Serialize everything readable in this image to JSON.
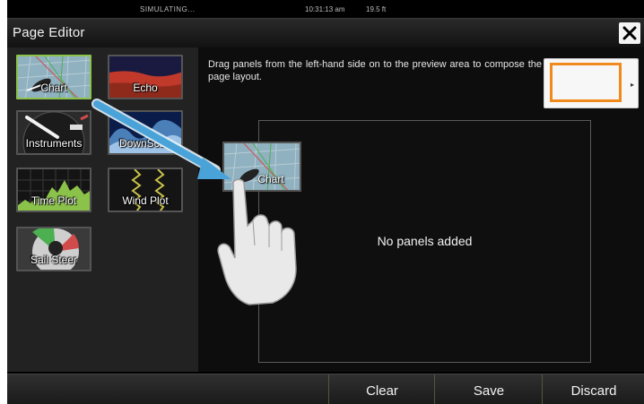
{
  "status": {
    "sim": "SIMULATING...",
    "time": "10:31:13 am",
    "depth": "19.5 ft"
  },
  "title": "Page Editor",
  "panels": [
    {
      "label": "Chart",
      "icon": "chart-icon"
    },
    {
      "label": "Echo",
      "icon": "echo-icon"
    },
    {
      "label": "Instruments",
      "icon": "instruments-icon"
    },
    {
      "label": "DownScan",
      "icon": "downscan-icon"
    },
    {
      "label": "Time Plot",
      "icon": "time-plot-icon"
    },
    {
      "label": "Wind Plot",
      "icon": "wind-plot-icon"
    },
    {
      "label": "Sail Steer",
      "icon": "sail-steer-icon"
    }
  ],
  "instructions": "Drag panels from the left-hand side on to the preview area to compose the page layout.",
  "preview": {
    "empty_message": "No panels added"
  },
  "dragged_panel": {
    "label": "Chart"
  },
  "buttons": {
    "clear": "Clear",
    "save": "Save",
    "discard": "Discard"
  },
  "colors": {
    "selected_border": "#8bc34a",
    "layout_frame": "#f08a1c",
    "arrow": "#4aa3d8"
  }
}
